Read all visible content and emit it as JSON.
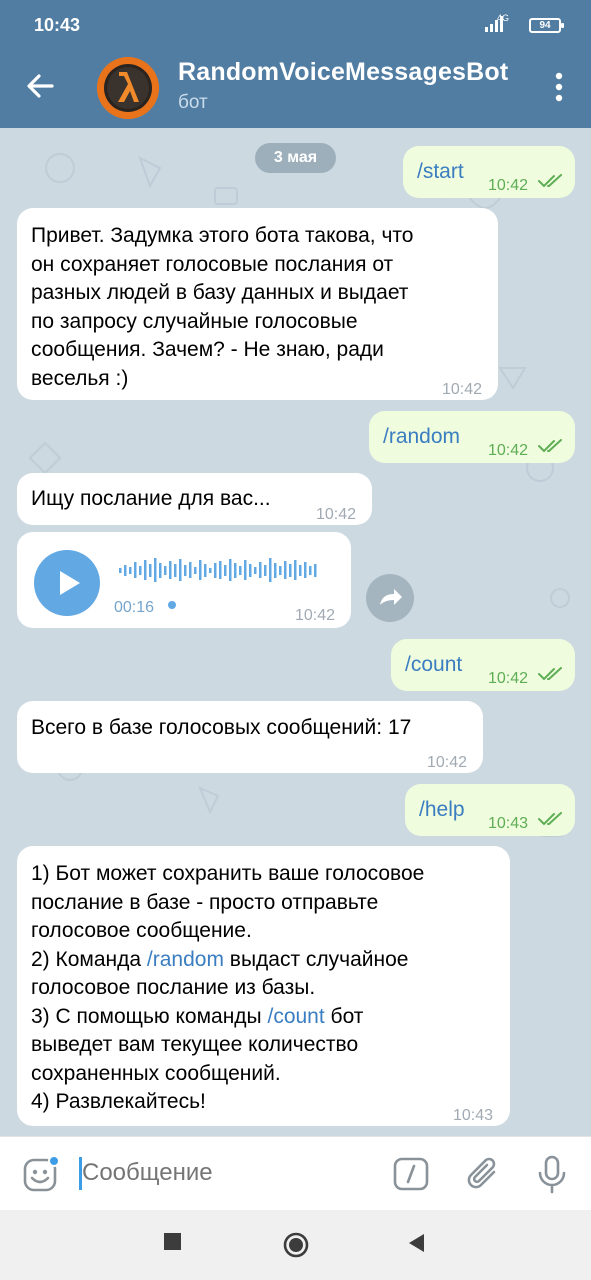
{
  "status_bar": {
    "time": "10:43",
    "network": "4G",
    "battery": "94"
  },
  "header": {
    "title": "RandomVoiceMessagesBot",
    "subtitle": "бот",
    "icons": [
      "back-arrow-icon",
      "bot-avatar",
      "more-vert-icon"
    ]
  },
  "chat": {
    "date": "3 мая",
    "messages": [
      {
        "dir": "out",
        "text": "/start",
        "time": "10:42",
        "read": true
      },
      {
        "dir": "in",
        "lines": [
          "Привет. Задумка этого бота такова, что",
          "он сохраняет голосовые послания от",
          "разных людей в базу данных и выдает",
          "по запросу случайные голосовые",
          "сообщения. Зачем? - Не знаю, ради",
          "веселья :)"
        ],
        "time": "10:42"
      },
      {
        "dir": "out",
        "text": "/random",
        "time": "10:42",
        "read": true
      },
      {
        "dir": "in",
        "text": "Ищу послание для вас...",
        "time": "10:42"
      },
      {
        "dir": "in",
        "type": "voice",
        "duration": "00:16",
        "time": "10:42",
        "unplayed": true
      },
      {
        "dir": "out",
        "text": "/count",
        "time": "10:42",
        "read": true
      },
      {
        "dir": "in",
        "text": "Всего в базе голосовых сообщений: 17",
        "time": "10:42"
      },
      {
        "dir": "out",
        "text": "/help",
        "time": "10:43",
        "read": true
      },
      {
        "dir": "in",
        "help": {
          "l1": "1) Бот может сохранить ваше голосовое",
          "l2": "послание в базе - просто отправьте",
          "l3": "голосовое сообщение.",
          "l4a": "2) Команда ",
          "l4link": "/random",
          "l4b": " выдаст случайное",
          "l5": "голосовое послание из базы.",
          "l6a": "3) С помощью команды ",
          "l6link": "/count",
          "l6b": " бот",
          "l7": "выведет вам текущее количество",
          "l8": "сохраненных сообщений.",
          "l9": "4) Развлекайтесь!"
        },
        "time": "10:43"
      }
    ]
  },
  "composer": {
    "placeholder": "Сообщение",
    "icons": [
      "emoji-icon",
      "bot-command-icon",
      "attach-icon",
      "mic-icon"
    ]
  },
  "nav": {
    "icons": [
      "recents-square-icon",
      "home-circle-icon",
      "back-triangle-icon"
    ]
  },
  "colors": {
    "header": "#517da2",
    "out_bubble": "#effdde",
    "link": "#3a7dc0",
    "accent": "#62a8e3",
    "check": "#5fad55"
  }
}
